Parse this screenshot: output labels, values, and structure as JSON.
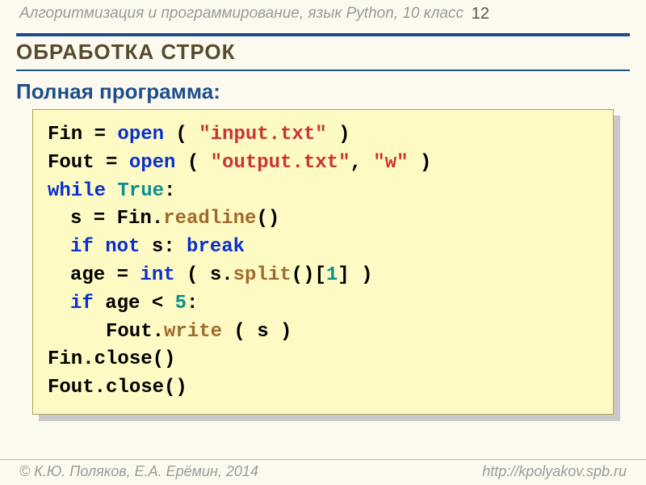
{
  "header": {
    "topic": "Алгоритмизация и программирование, язык Python, 10 класс",
    "page": "12"
  },
  "section_title": "ОБРАБОТКА СТРОК",
  "subtitle": "Полная программа:",
  "code": {
    "l1_a": "Fin = ",
    "l1_open": "open",
    "l1_b": " ( ",
    "l1_str": "\"input.txt\"",
    "l1_c": " )",
    "l2_a": "Fout = ",
    "l2_open": "open",
    "l2_b": " ( ",
    "l2_str1": "\"output.txt\"",
    "l2_c": ", ",
    "l2_str2": "\"w\"",
    "l2_d": " )",
    "l3_while": "while",
    "l3_sp": " ",
    "l3_true": "True",
    "l3_colon": ":",
    "l4_a": "s = Fin.",
    "l4_fn": "readline",
    "l4_b": "()",
    "l5_if": "if",
    "l5_a": " ",
    "l5_not": "not",
    "l5_b": " s: ",
    "l5_break": "break",
    "l6_a": "age = ",
    "l6_int": "int",
    "l6_b": " ( s.",
    "l6_split": "split",
    "l6_c": "()[",
    "l6_num": "1",
    "l6_d": "] )",
    "l7_if": "if",
    "l7_a": " age < ",
    "l7_num": "5",
    "l7_b": ":",
    "l8_a": "Fout.",
    "l8_fn": "write",
    "l8_b": " ( s )",
    "l9": "Fin.close()",
    "l10": "Fout.close()"
  },
  "footer": {
    "left": "© К.Ю. Поляков, Е.А. Ерёмин, 2014",
    "right": "http://kpolyakov.spb.ru"
  }
}
